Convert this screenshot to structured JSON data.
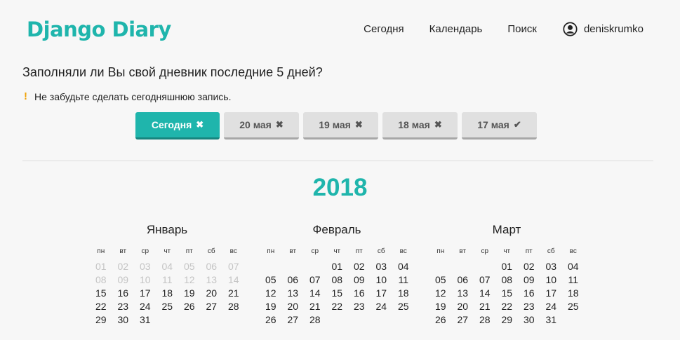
{
  "header": {
    "logo": "Django Diary",
    "nav": [
      "Сегодня",
      "Календарь",
      "Поиск"
    ],
    "username": "deniskrumko"
  },
  "diary": {
    "question": "Заполняли ли Вы свой дневник последние 5 дней?",
    "reminder": "Не забудьте сделать сегодняшнюю запись.",
    "days": [
      {
        "label": "Сегодня",
        "mark": "✖",
        "active": true
      },
      {
        "label": "20 мая",
        "mark": "✖",
        "active": false
      },
      {
        "label": "19 мая",
        "mark": "✖",
        "active": false
      },
      {
        "label": "18 мая",
        "mark": "✖",
        "active": false
      },
      {
        "label": "17 мая",
        "mark": "✔",
        "active": false
      }
    ]
  },
  "calendar": {
    "year": "2018",
    "weekdays": [
      "пн",
      "вт",
      "ср",
      "чт",
      "пт",
      "сб",
      "вс"
    ],
    "months": [
      {
        "name": "Январь",
        "days": [
          "01",
          "02",
          "03",
          "04",
          "05",
          "06",
          "07",
          "08",
          "09",
          "10",
          "11",
          "12",
          "13",
          "14",
          "15",
          "16",
          "17",
          "18",
          "19",
          "20",
          "21",
          "22",
          "23",
          "24",
          "25",
          "26",
          "27",
          "28",
          "29",
          "30",
          "31"
        ],
        "offset": 0,
        "dim_through": 15
      },
      {
        "name": "Февраль",
        "days": [
          "01",
          "02",
          "03",
          "04",
          "05",
          "06",
          "07",
          "08",
          "09",
          "10",
          "11",
          "12",
          "13",
          "14",
          "15",
          "16",
          "17",
          "18",
          "19",
          "20",
          "21",
          "22",
          "23",
          "24",
          "25",
          "26",
          "27",
          "28"
        ],
        "offset": 3,
        "dim_through": 0
      },
      {
        "name": "Март",
        "days": [
          "01",
          "02",
          "03",
          "04",
          "05",
          "06",
          "07",
          "08",
          "09",
          "10",
          "11",
          "12",
          "13",
          "14",
          "15",
          "16",
          "17",
          "18",
          "19",
          "20",
          "21",
          "22",
          "23",
          "24",
          "25",
          "26",
          "27",
          "28",
          "29",
          "30",
          "31"
        ],
        "offset": 3,
        "dim_through": 0
      }
    ]
  },
  "colors": {
    "accent": "#1fb5ac",
    "warning": "#f0a30a"
  }
}
